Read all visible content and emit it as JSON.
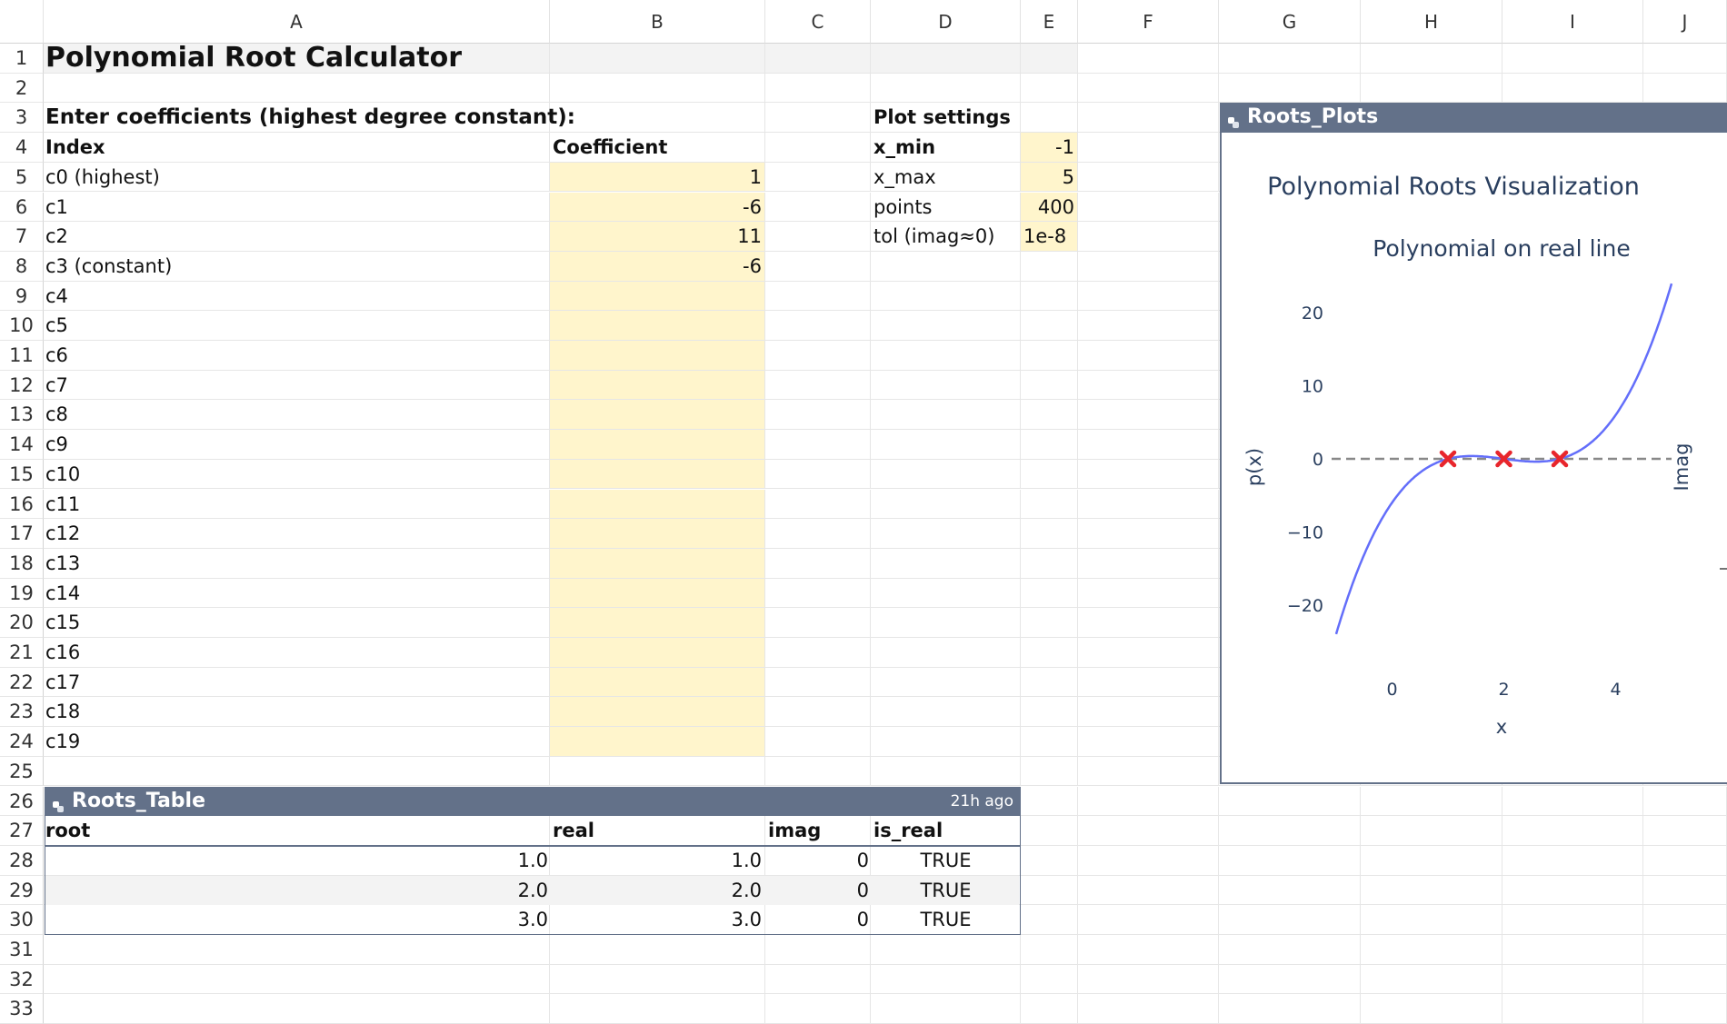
{
  "columns": [
    "A",
    "B",
    "C",
    "D",
    "E",
    "F",
    "G",
    "H",
    "I",
    "J"
  ],
  "rows": [
    "1",
    "2",
    "3",
    "4",
    "5",
    "6",
    "7",
    "8",
    "9",
    "10",
    "11",
    "12",
    "13",
    "14",
    "15",
    "16",
    "17",
    "18",
    "19",
    "20",
    "21",
    "22",
    "23",
    "24",
    "25",
    "26",
    "27",
    "28",
    "29",
    "30",
    "31",
    "32",
    "33"
  ],
  "title": "Polynomial Root Calculator",
  "instructions": "Enter coefficients (highest degree  constant):",
  "coef_table": {
    "index_header": "Index",
    "coef_header": "Coefficient",
    "indices": [
      "c0 (highest)",
      "c1",
      "c2",
      "c3 (constant)",
      "c4",
      "c5",
      "c6",
      "c7",
      "c8",
      "c9",
      "c10",
      "c11",
      "c12",
      "c13",
      "c14",
      "c15",
      "c16",
      "c17",
      "c18",
      "c19"
    ],
    "coefs": [
      "1",
      "-6",
      "11",
      "-6",
      "",
      "",
      "",
      "",
      "",
      "",
      "",
      "",
      "",
      "",
      "",
      "",
      "",
      "",
      "",
      ""
    ]
  },
  "plot_settings": {
    "title": "Plot settings",
    "labels": [
      "x_min",
      "x_max",
      "points",
      "tol (imag≈0)"
    ],
    "values": [
      "-1",
      "5",
      "400",
      "1e-8"
    ]
  },
  "roots_table": {
    "name": "Roots_Table",
    "ago": "21h ago",
    "headers": [
      "root",
      "real",
      "imag",
      "is_real"
    ],
    "rows": [
      [
        "1.0",
        "1.0",
        "0",
        "TRUE"
      ],
      [
        "2.0",
        "2.0",
        "0",
        "TRUE"
      ],
      [
        "3.0",
        "3.0",
        "0",
        "TRUE"
      ]
    ]
  },
  "plots_panel": {
    "name": "Roots_Plots",
    "figure_title": "Polynomial Roots Visualization",
    "right_axis_label": "Imag"
  },
  "chart_data": {
    "type": "line",
    "title": "Polynomial on real line",
    "xlabel": "x",
    "ylabel": "p(x)",
    "xlim": [
      -1,
      5
    ],
    "ylim": [
      -26,
      26
    ],
    "xticks": [
      0,
      2,
      4
    ],
    "yticks": [
      20,
      10,
      0,
      -10,
      -20
    ],
    "ytick_labels": [
      "20",
      "10",
      "0",
      "−10",
      "−20"
    ],
    "coefficients": [
      1,
      -6,
      11,
      -6
    ],
    "roots": [
      {
        "x": 1,
        "y": 0
      },
      {
        "x": 2,
        "y": 0
      },
      {
        "x": 3,
        "y": 0
      }
    ],
    "zero_line": true,
    "colors": {
      "curve": "#636efa",
      "roots": "#e8262c",
      "zero_line": "#888888"
    }
  },
  "colors": {
    "table_header": "#637189",
    "input_fill": "#fff5cc",
    "chart_text": "#2a3f5f"
  }
}
